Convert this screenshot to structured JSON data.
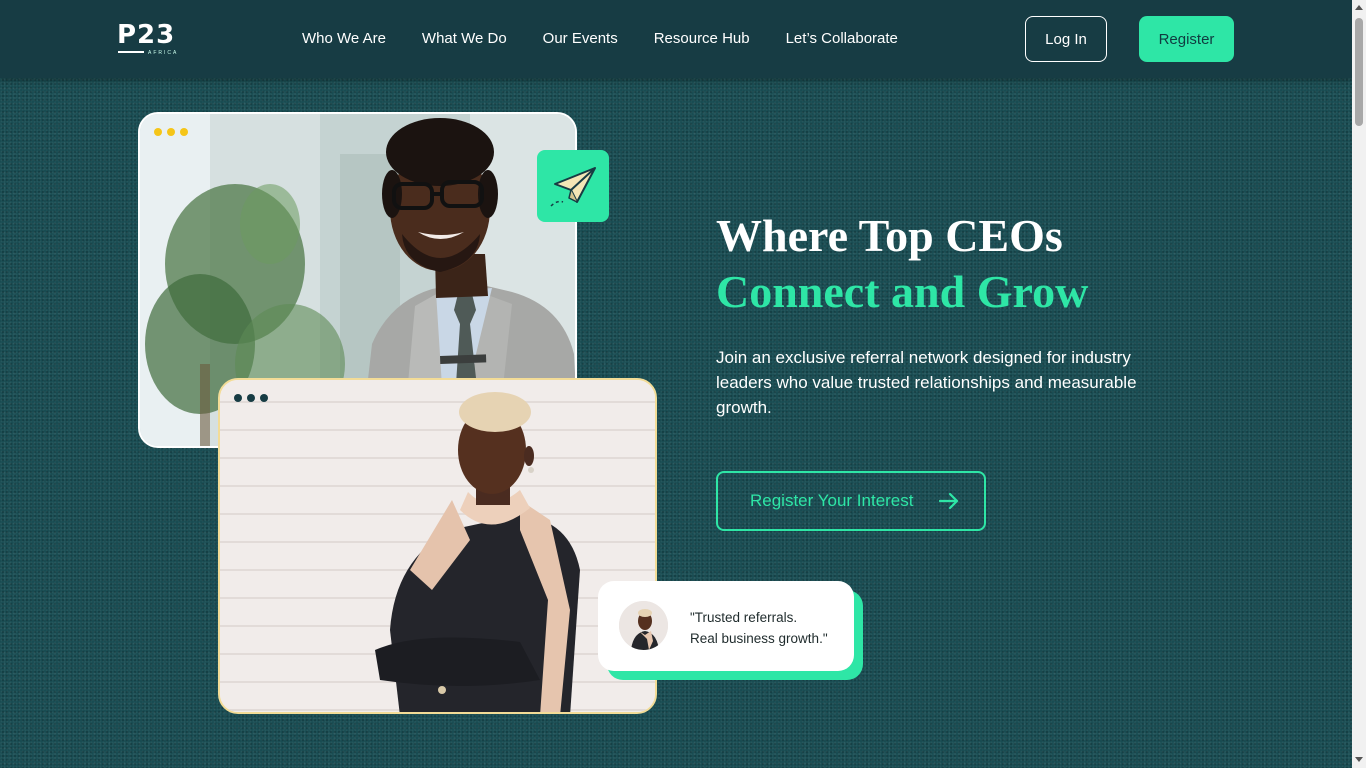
{
  "brand": {
    "logo_text": "P23",
    "logo_sub": "AFRICA"
  },
  "nav": {
    "links": [
      "Who We Are",
      "What We Do",
      "Our Events",
      "Resource Hub",
      "Let’s Collaborate"
    ],
    "login_label": "Log In",
    "register_label": "Register"
  },
  "hero": {
    "title_line1": "Where Top CEOs",
    "title_line2": "Connect and Grow",
    "subtitle": "Join an exclusive referral network designed for industry leaders who value trusted relationships and measurable growth.",
    "cta_label": "Register Your Interest",
    "cta_icon": "arrow-right-icon"
  },
  "quote": {
    "line1": "\"Trusted referrals.",
    "line2": "Real business growth.\""
  },
  "colors": {
    "accent": "#2ee6a6",
    "navbar": "#173c44",
    "background": "#164a50",
    "card1_dots": "#f5c518",
    "card2_dots": "#173c44",
    "card2_border": "#f3dc97"
  }
}
